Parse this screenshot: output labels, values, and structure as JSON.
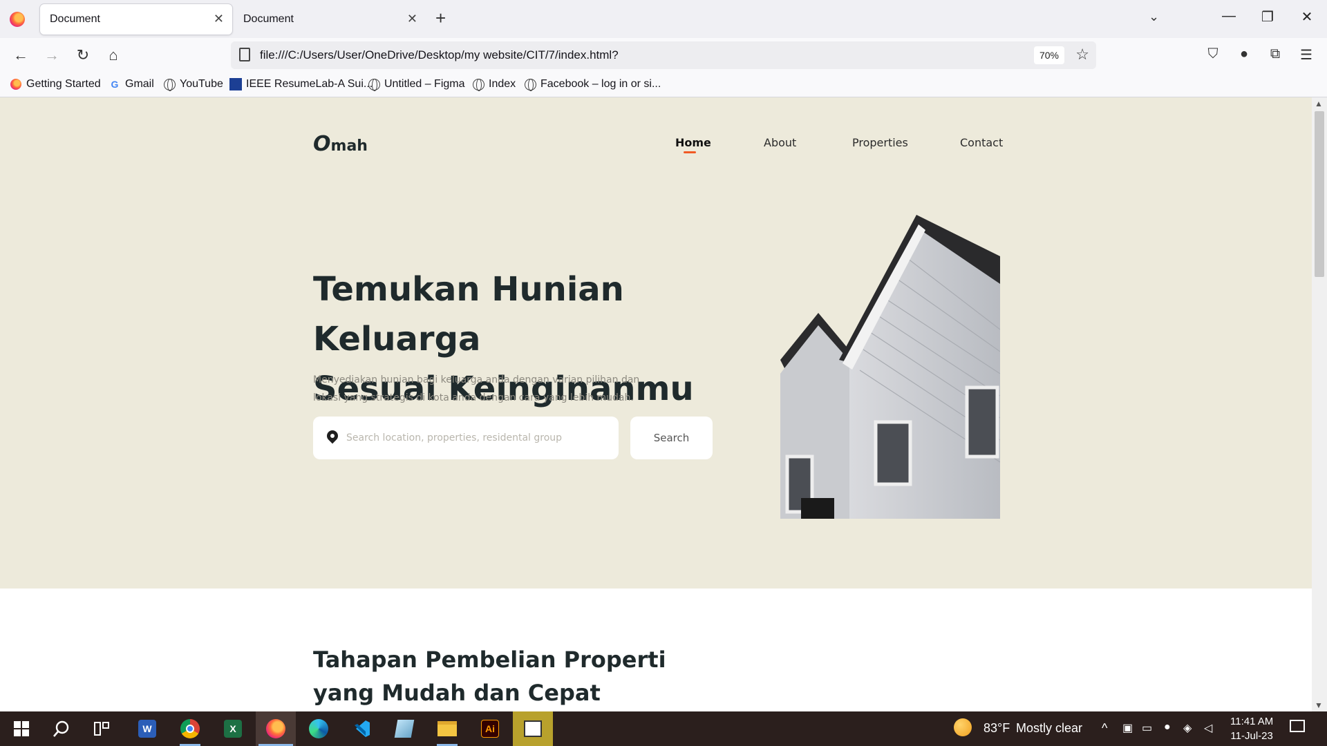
{
  "browser": {
    "tabs": [
      {
        "title": "Document",
        "active": true
      },
      {
        "title": "Document",
        "active": false
      }
    ],
    "new_tab_glyph": "+",
    "url": "file:///C:/Users/User/OneDrive/Desktop/my website/CIT/7/index.html?",
    "zoom": "70%",
    "bookmarks": [
      {
        "label": "Getting Started",
        "icon": "firefox-icon"
      },
      {
        "label": "Gmail",
        "icon": "google-icon"
      },
      {
        "label": "YouTube",
        "icon": "globe-icon"
      },
      {
        "label": "IEEE ResumeLab-A Sui...",
        "icon": "ieee-icon"
      },
      {
        "label": "Untitled – Figma",
        "icon": "globe-icon"
      },
      {
        "label": "Index",
        "icon": "globe-icon"
      },
      {
        "label": "Facebook – log in or si...",
        "icon": "globe-icon"
      }
    ]
  },
  "page": {
    "logo": {
      "mark": "O",
      "text": "mah"
    },
    "nav": [
      {
        "label": "Home",
        "active": true
      },
      {
        "label": "About",
        "active": false
      },
      {
        "label": "Properties",
        "active": false
      },
      {
        "label": "Contact",
        "active": false
      }
    ],
    "hero": {
      "title_line1": "Temukan Hunian Keluarga",
      "title_line2": "Sesuai Keinginanmu",
      "subtitle_line1": "Menyediakan hunian bagi keluarga anda dengan varian pilihan dan",
      "subtitle_line2": "lokasi yang strategis di kota anda dengan cara yang lebih mudah.",
      "search_placeholder": "Search location, properties, residental group",
      "search_button": "Search"
    },
    "section2": {
      "title_line1": "Tahapan Pembelian Properti",
      "title_line2": "yang Mudah dan Cepat"
    },
    "colors": {
      "hero_bg": "#edeadb",
      "accent": "#f15a24",
      "heading": "#1f2a2c"
    }
  },
  "taskbar": {
    "weather_temp": "83°F",
    "weather_text": "Mostly clear",
    "time": "11:41 AM",
    "date": "11-Jul-23"
  }
}
